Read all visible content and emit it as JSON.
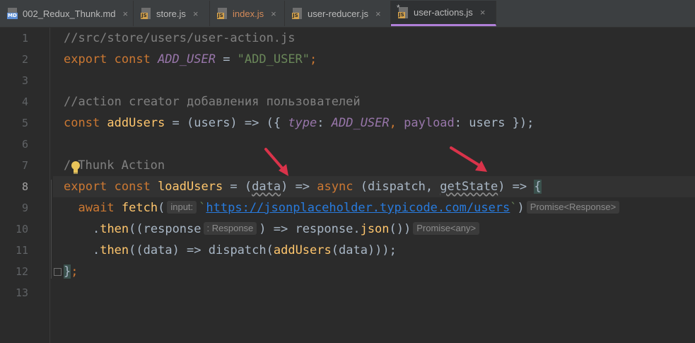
{
  "tabs": [
    {
      "label": "002_Redux_Thunk.md",
      "icon": "md-file-icon",
      "badge": "MD",
      "active": false,
      "modified": false
    },
    {
      "label": "store.js",
      "icon": "js-file-icon",
      "badge": "JS",
      "active": false,
      "modified": false
    },
    {
      "label": "index.js",
      "icon": "js-file-icon",
      "badge": "JS",
      "active": false,
      "modified": true
    },
    {
      "label": "user-reducer.js",
      "icon": "js-file-icon",
      "badge": "JS",
      "active": false,
      "modified": false
    },
    {
      "label": "user-actions.js",
      "icon": "js-file-icon",
      "badge": "JS",
      "active": true,
      "modified": false,
      "prefix": "*"
    }
  ],
  "close_glyph": "×",
  "line_numbers": [
    "1",
    "2",
    "3",
    "4",
    "5",
    "6",
    "7",
    "8",
    "9",
    "10",
    "11",
    "12",
    "13"
  ],
  "code": {
    "l1": "//src/store/users/user-action.js",
    "l2": {
      "kw": "export const ",
      "cst": "ADD_USER",
      "eq": " = ",
      "str": "\"ADD_USER\"",
      "semi": ";"
    },
    "l4": "//action creator добавления пользователей",
    "l5": {
      "kw": "const ",
      "fn": "addUsers",
      "a": " = (users) => ({ ",
      "type": "type",
      "c1": ": ",
      "cst": "ADD_USER",
      "c2": ", ",
      "payload": "payload",
      "c3": ": users });"
    },
    "l7": {
      "a": "/",
      "b": "Thunk Action"
    },
    "l8": {
      "kw1": "export const ",
      "fn": "loadUsers",
      "a": " = (",
      "data": "data",
      "b": ") => ",
      "kw2": "async",
      "c": " (dispatch, ",
      "gs": "getState",
      "d": ") => ",
      "brace": "{"
    },
    "l9": {
      "kw": "await ",
      "fn": "fetch",
      "a": "(",
      "hint1": "input:",
      "str1": "`",
      "url": "https://jsonplaceholder.typicode.com/users",
      "str2": "`",
      "b": ")",
      "hint2": "Promise<Response>"
    },
    "l10": {
      "a": ".",
      "fn": "then",
      "b": "((response",
      "hint": ": Response",
      "c": ") => response.",
      "fn2": "json",
      "d": "())",
      "hint2": "Promise<any>"
    },
    "l11": {
      "a": ".",
      "fn": "then",
      "b": "((data) => dispatch(",
      "fn2": "addUsers",
      "c": "(data)));"
    },
    "l12": {
      "brace": "}",
      "semi": ";"
    }
  },
  "colors": {
    "accent": "#b07fd8",
    "arrow": "#d9334a",
    "keyword": "#cc7832",
    "constant": "#9876aa",
    "string": "#6a8759",
    "function": "#ffc66d"
  }
}
